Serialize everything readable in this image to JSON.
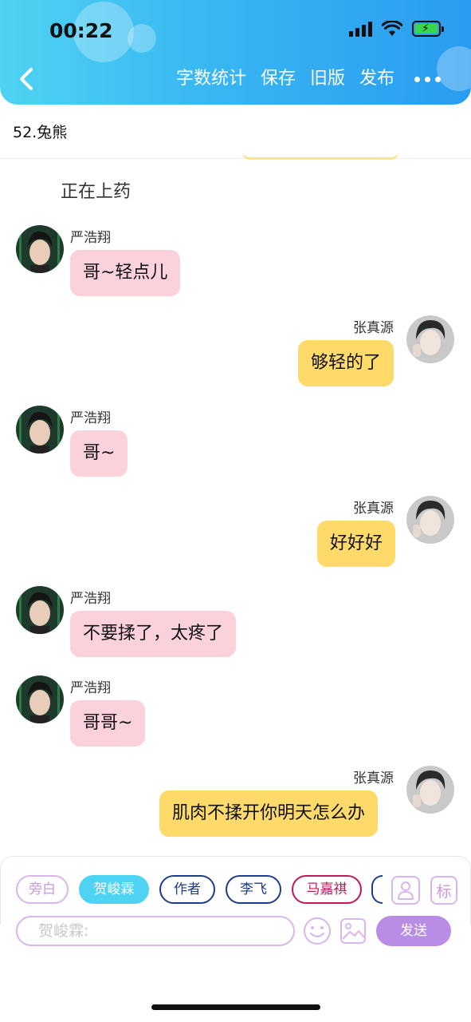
{
  "status_bar": {
    "time": "00:22"
  },
  "nav": {
    "actions": [
      "字数统计",
      "保存",
      "旧版",
      "发布"
    ]
  },
  "story_title": "52.兔熊",
  "chat": {
    "narration": "正在上药",
    "messages": [
      {
        "sender": "严浩翔",
        "side": "left",
        "text": "哥~轻点儿",
        "bubble_color": "#fbd2dc"
      },
      {
        "sender": "张真源",
        "side": "right",
        "text": "够轻的了",
        "bubble_color": "#fdda6a"
      },
      {
        "sender": "严浩翔",
        "side": "left",
        "text": "哥~",
        "bubble_color": "#fbd2dc"
      },
      {
        "sender": "张真源",
        "side": "right",
        "text": "好好好",
        "bubble_color": "#fdda6a"
      },
      {
        "sender": "严浩翔",
        "side": "left",
        "text": "不要揉了，太疼了",
        "bubble_color": "#fbd2dc"
      },
      {
        "sender": "严浩翔",
        "side": "left",
        "text": "哥哥~",
        "bubble_color": "#fbd2dc"
      },
      {
        "sender": "张真源",
        "side": "right",
        "text": "肌肉不揉开你明天怎么办",
        "bubble_color": "#fdda6a"
      }
    ]
  },
  "composer": {
    "roles": [
      {
        "label": "旁白",
        "color": "#d9b6ec",
        "selected": false
      },
      {
        "label": "贺峻霖",
        "color": "#4fd3f2",
        "selected": true
      },
      {
        "label": "作者",
        "color": "#1f3c88",
        "selected": false
      },
      {
        "label": "李飞",
        "color": "#1f3c88",
        "selected": false
      },
      {
        "label": "马嘉祺",
        "color": "#c2185b",
        "selected": false
      }
    ],
    "tag_label": "标",
    "input_placeholder": "贺峻霖:",
    "send_label": "发送",
    "icons": [
      "role-manage-icon",
      "tag-icon",
      "emoji-icon",
      "image-icon"
    ]
  },
  "accent_colors": {
    "header_start": "#4fd3f2",
    "header_end": "#2a9cf0",
    "composer": "#b98de6"
  }
}
